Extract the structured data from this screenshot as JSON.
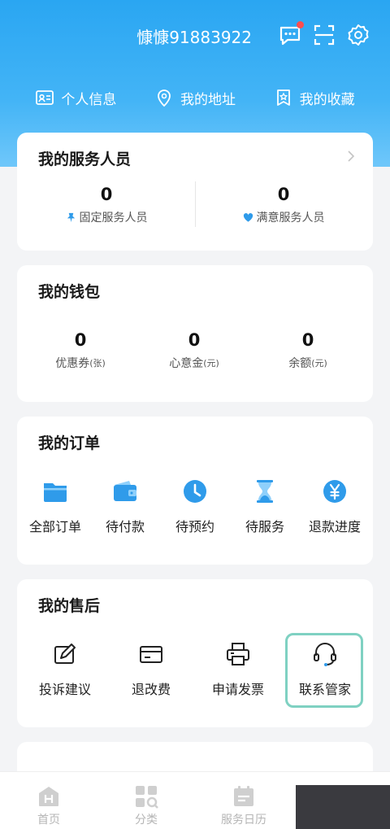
{
  "header": {
    "username": "慷慷91883922",
    "colors": {
      "primary": "#2aa6f2",
      "accent": "#2f9bea",
      "badge": "#ff4d4f"
    },
    "icons": [
      "message-icon",
      "scan-icon",
      "gear-icon"
    ]
  },
  "quicklinks": [
    {
      "label": "个人信息",
      "icon": "id-card-icon"
    },
    {
      "label": "我的地址",
      "icon": "location-icon"
    },
    {
      "label": "我的收藏",
      "icon": "bookmark-icon"
    }
  ],
  "service_staff": {
    "title": "我的服务人员",
    "items": [
      {
        "value": "0",
        "label": "固定服务人员",
        "icon": "pin-icon"
      },
      {
        "value": "0",
        "label": "满意服务人员",
        "icon": "heart-icon"
      }
    ]
  },
  "wallet": {
    "title": "我的钱包",
    "items": [
      {
        "value": "0",
        "label": "优惠券",
        "unit": "(张)"
      },
      {
        "value": "0",
        "label": "心意金",
        "unit": "(元)"
      },
      {
        "value": "0",
        "label": "余额",
        "unit": "(元)"
      }
    ]
  },
  "orders": {
    "title": "我的订单",
    "items": [
      {
        "label": "全部订单",
        "icon": "folder-icon"
      },
      {
        "label": "待付款",
        "icon": "wallet-icon"
      },
      {
        "label": "待预约",
        "icon": "clock-icon"
      },
      {
        "label": "待服务",
        "icon": "hourglass-icon"
      },
      {
        "label": "退款进度",
        "icon": "yen-icon"
      }
    ]
  },
  "after_sales": {
    "title": "我的售后",
    "items": [
      {
        "label": "投诉建议",
        "icon": "edit-icon"
      },
      {
        "label": "退改费",
        "icon": "card-icon"
      },
      {
        "label": "申请发票",
        "icon": "printer-icon"
      },
      {
        "label": "联系管家",
        "icon": "headset-icon"
      }
    ]
  },
  "tabbar": {
    "items": [
      {
        "label": "首页",
        "icon": "home-icon"
      },
      {
        "label": "分类",
        "icon": "category-icon"
      },
      {
        "label": "服务日历",
        "icon": "calendar-icon"
      }
    ]
  }
}
